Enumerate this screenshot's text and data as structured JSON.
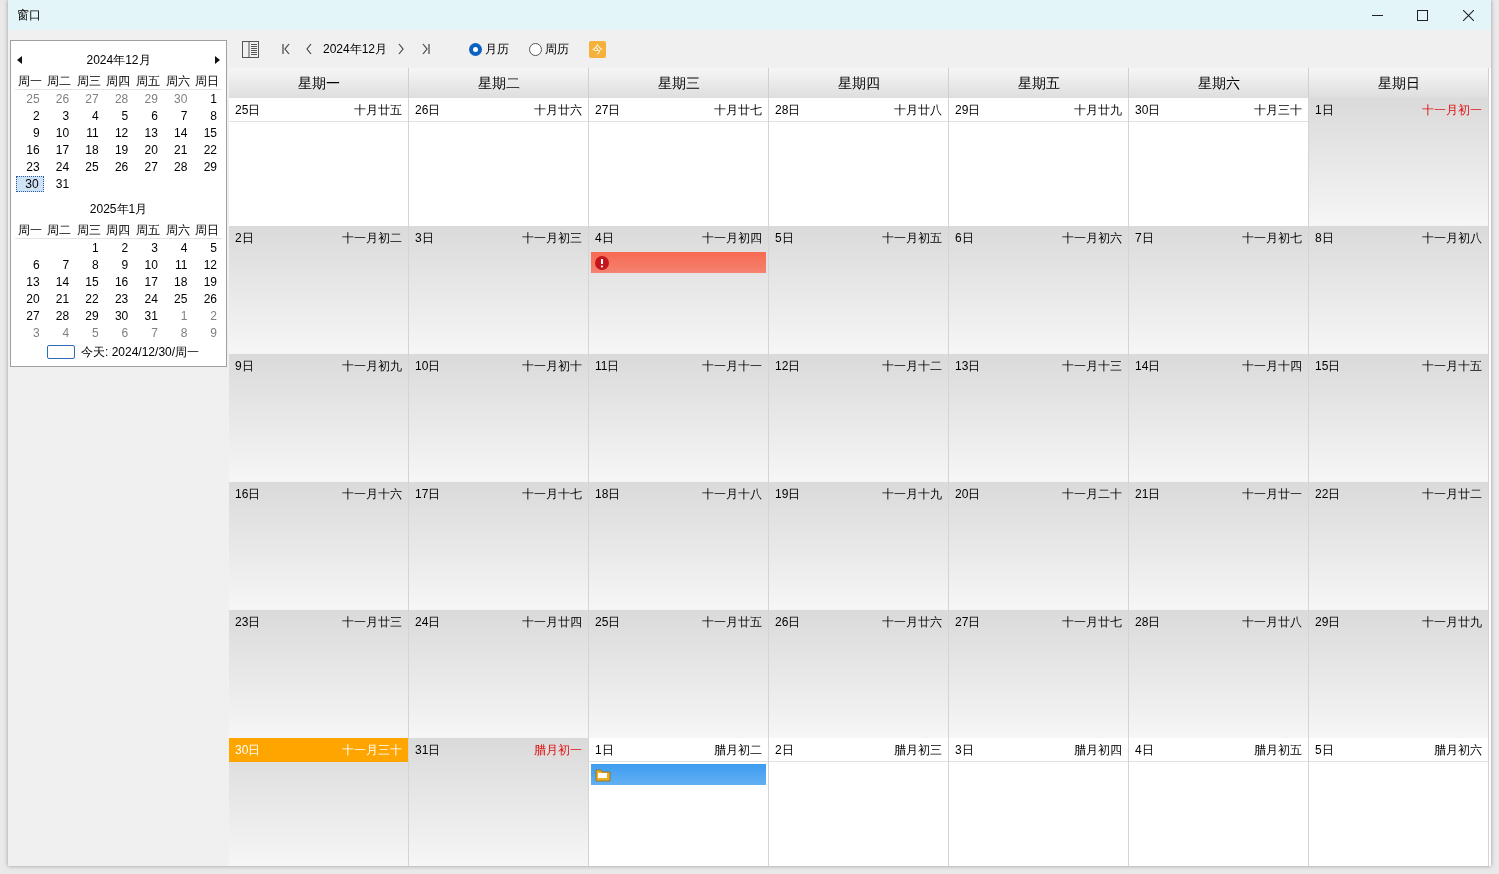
{
  "window": {
    "title": "窗口"
  },
  "mini_calendars": [
    {
      "title": "2024年12月",
      "weekdays": [
        "周一",
        "周二",
        "周三",
        "周四",
        "周五",
        "周六",
        "周日"
      ],
      "weeks": [
        [
          {
            "label": "25",
            "dim": true,
            "selected": false
          },
          {
            "label": "26",
            "dim": true,
            "selected": false
          },
          {
            "label": "27",
            "dim": true,
            "selected": false
          },
          {
            "label": "28",
            "dim": true,
            "selected": false
          },
          {
            "label": "29",
            "dim": true,
            "selected": false
          },
          {
            "label": "30",
            "dim": true,
            "selected": false
          },
          {
            "label": "1",
            "dim": false,
            "selected": false
          }
        ],
        [
          {
            "label": "2",
            "dim": false,
            "selected": false
          },
          {
            "label": "3",
            "dim": false,
            "selected": false
          },
          {
            "label": "4",
            "dim": false,
            "selected": false
          },
          {
            "label": "5",
            "dim": false,
            "selected": false
          },
          {
            "label": "6",
            "dim": false,
            "selected": false
          },
          {
            "label": "7",
            "dim": false,
            "selected": false
          },
          {
            "label": "8",
            "dim": false,
            "selected": false
          }
        ],
        [
          {
            "label": "9",
            "dim": false,
            "selected": false
          },
          {
            "label": "10",
            "dim": false,
            "selected": false
          },
          {
            "label": "11",
            "dim": false,
            "selected": false
          },
          {
            "label": "12",
            "dim": false,
            "selected": false
          },
          {
            "label": "13",
            "dim": false,
            "selected": false
          },
          {
            "label": "14",
            "dim": false,
            "selected": false
          },
          {
            "label": "15",
            "dim": false,
            "selected": false
          }
        ],
        [
          {
            "label": "16",
            "dim": false,
            "selected": false
          },
          {
            "label": "17",
            "dim": false,
            "selected": false
          },
          {
            "label": "18",
            "dim": false,
            "selected": false
          },
          {
            "label": "19",
            "dim": false,
            "selected": false
          },
          {
            "label": "20",
            "dim": false,
            "selected": false
          },
          {
            "label": "21",
            "dim": false,
            "selected": false
          },
          {
            "label": "22",
            "dim": false,
            "selected": false
          }
        ],
        [
          {
            "label": "23",
            "dim": false,
            "selected": false
          },
          {
            "label": "24",
            "dim": false,
            "selected": false
          },
          {
            "label": "25",
            "dim": false,
            "selected": false
          },
          {
            "label": "26",
            "dim": false,
            "selected": false
          },
          {
            "label": "27",
            "dim": false,
            "selected": false
          },
          {
            "label": "28",
            "dim": false,
            "selected": false
          },
          {
            "label": "29",
            "dim": false,
            "selected": false
          }
        ],
        [
          {
            "label": "30",
            "dim": false,
            "selected": true
          },
          {
            "label": "31",
            "dim": false,
            "selected": false
          }
        ]
      ]
    },
    {
      "title": "2025年1月",
      "weekdays": [
        "周一",
        "周二",
        "周三",
        "周四",
        "周五",
        "周六",
        "周日"
      ],
      "weeks": [
        [
          {
            "label": "1",
            "dim": false,
            "selected": false
          },
          {
            "label": "2",
            "dim": false,
            "selected": false
          },
          {
            "label": "3",
            "dim": false,
            "selected": false
          },
          {
            "label": "4",
            "dim": false,
            "selected": false
          },
          {
            "label": "5",
            "dim": false,
            "selected": false
          }
        ],
        [
          {
            "label": "6",
            "dim": false,
            "selected": false
          },
          {
            "label": "7",
            "dim": false,
            "selected": false
          },
          {
            "label": "8",
            "dim": false,
            "selected": false
          },
          {
            "label": "9",
            "dim": false,
            "selected": false
          },
          {
            "label": "10",
            "dim": false,
            "selected": false
          },
          {
            "label": "11",
            "dim": false,
            "selected": false
          },
          {
            "label": "12",
            "dim": false,
            "selected": false
          }
        ],
        [
          {
            "label": "13",
            "dim": false,
            "selected": false
          },
          {
            "label": "14",
            "dim": false,
            "selected": false
          },
          {
            "label": "15",
            "dim": false,
            "selected": false
          },
          {
            "label": "16",
            "dim": false,
            "selected": false
          },
          {
            "label": "17",
            "dim": false,
            "selected": false
          },
          {
            "label": "18",
            "dim": false,
            "selected": false
          },
          {
            "label": "19",
            "dim": false,
            "selected": false
          }
        ],
        [
          {
            "label": "20",
            "dim": false,
            "selected": false
          },
          {
            "label": "21",
            "dim": false,
            "selected": false
          },
          {
            "label": "22",
            "dim": false,
            "selected": false
          },
          {
            "label": "23",
            "dim": false,
            "selected": false
          },
          {
            "label": "24",
            "dim": false,
            "selected": false
          },
          {
            "label": "25",
            "dim": false,
            "selected": false
          },
          {
            "label": "26",
            "dim": false,
            "selected": false
          }
        ],
        [
          {
            "label": "27",
            "dim": false,
            "selected": false
          },
          {
            "label": "28",
            "dim": false,
            "selected": false
          },
          {
            "label": "29",
            "dim": false,
            "selected": false
          },
          {
            "label": "30",
            "dim": false,
            "selected": false
          },
          {
            "label": "31",
            "dim": false,
            "selected": false
          },
          {
            "label": "1",
            "dim": true,
            "selected": false
          },
          {
            "label": "2",
            "dim": true,
            "selected": false
          }
        ],
        [
          {
            "label": "3",
            "dim": true,
            "selected": false
          },
          {
            "label": "4",
            "dim": true,
            "selected": false
          },
          {
            "label": "5",
            "dim": true,
            "selected": false
          },
          {
            "label": "6",
            "dim": true,
            "selected": false
          },
          {
            "label": "7",
            "dim": true,
            "selected": false
          },
          {
            "label": "8",
            "dim": true,
            "selected": false
          },
          {
            "label": "9",
            "dim": true,
            "selected": false
          }
        ]
      ]
    }
  ],
  "today_label": "今天: 2024/12/30/周一",
  "toolbar": {
    "month_label": "2024年12月",
    "views": [
      {
        "label": "月历",
        "selected": true
      },
      {
        "label": "周历",
        "selected": false
      }
    ],
    "today_button": "今"
  },
  "calendar": {
    "weekdays": [
      "星期一",
      "星期二",
      "星期三",
      "星期四",
      "星期五",
      "星期六",
      "星期日"
    ],
    "weeks": [
      [
        {
          "date": "25日",
          "lunar": "十月廿五",
          "other_month": true,
          "today": false,
          "lunar_highlight": false
        },
        {
          "date": "26日",
          "lunar": "十月廿六",
          "other_month": true,
          "today": false,
          "lunar_highlight": false
        },
        {
          "date": "27日",
          "lunar": "十月廿七",
          "other_month": true,
          "today": false,
          "lunar_highlight": false
        },
        {
          "date": "28日",
          "lunar": "十月廿八",
          "other_month": true,
          "today": false,
          "lunar_highlight": false
        },
        {
          "date": "29日",
          "lunar": "十月廿九",
          "other_month": true,
          "today": false,
          "lunar_highlight": false
        },
        {
          "date": "30日",
          "lunar": "十月三十",
          "other_month": true,
          "today": false,
          "lunar_highlight": false
        },
        {
          "date": "1日",
          "lunar": "十一月初一",
          "other_month": false,
          "today": false,
          "lunar_highlight": true
        }
      ],
      [
        {
          "date": "2日",
          "lunar": "十一月初二",
          "other_month": false,
          "today": false,
          "lunar_highlight": false
        },
        {
          "date": "3日",
          "lunar": "十一月初三",
          "other_month": false,
          "today": false,
          "lunar_highlight": false
        },
        {
          "date": "4日",
          "lunar": "十一月初四",
          "other_month": false,
          "today": false,
          "lunar_highlight": false,
          "events": [
            {
              "kind": "alert",
              "color": "#f86a52"
            }
          ]
        },
        {
          "date": "5日",
          "lunar": "十一月初五",
          "other_month": false,
          "today": false,
          "lunar_highlight": false
        },
        {
          "date": "6日",
          "lunar": "十一月初六",
          "other_month": false,
          "today": false,
          "lunar_highlight": false
        },
        {
          "date": "7日",
          "lunar": "十一月初七",
          "other_month": false,
          "today": false,
          "lunar_highlight": false
        },
        {
          "date": "8日",
          "lunar": "十一月初八",
          "other_month": false,
          "today": false,
          "lunar_highlight": false
        }
      ],
      [
        {
          "date": "9日",
          "lunar": "十一月初九",
          "other_month": false,
          "today": false,
          "lunar_highlight": false
        },
        {
          "date": "10日",
          "lunar": "十一月初十",
          "other_month": false,
          "today": false,
          "lunar_highlight": false
        },
        {
          "date": "11日",
          "lunar": "十一月十一",
          "other_month": false,
          "today": false,
          "lunar_highlight": false
        },
        {
          "date": "12日",
          "lunar": "十一月十二",
          "other_month": false,
          "today": false,
          "lunar_highlight": false
        },
        {
          "date": "13日",
          "lunar": "十一月十三",
          "other_month": false,
          "today": false,
          "lunar_highlight": false
        },
        {
          "date": "14日",
          "lunar": "十一月十四",
          "other_month": false,
          "today": false,
          "lunar_highlight": false
        },
        {
          "date": "15日",
          "lunar": "十一月十五",
          "other_month": false,
          "today": false,
          "lunar_highlight": false
        }
      ],
      [
        {
          "date": "16日",
          "lunar": "十一月十六",
          "other_month": false,
          "today": false,
          "lunar_highlight": false
        },
        {
          "date": "17日",
          "lunar": "十一月十七",
          "other_month": false,
          "today": false,
          "lunar_highlight": false
        },
        {
          "date": "18日",
          "lunar": "十一月十八",
          "other_month": false,
          "today": false,
          "lunar_highlight": false
        },
        {
          "date": "19日",
          "lunar": "十一月十九",
          "other_month": false,
          "today": false,
          "lunar_highlight": false
        },
        {
          "date": "20日",
          "lunar": "十一月二十",
          "other_month": false,
          "today": false,
          "lunar_highlight": false
        },
        {
          "date": "21日",
          "lunar": "十一月廿一",
          "other_month": false,
          "today": false,
          "lunar_highlight": false
        },
        {
          "date": "22日",
          "lunar": "十一月廿二",
          "other_month": false,
          "today": false,
          "lunar_highlight": false
        }
      ],
      [
        {
          "date": "23日",
          "lunar": "十一月廿三",
          "other_month": false,
          "today": false,
          "lunar_highlight": false
        },
        {
          "date": "24日",
          "lunar": "十一月廿四",
          "other_month": false,
          "today": false,
          "lunar_highlight": false
        },
        {
          "date": "25日",
          "lunar": "十一月廿五",
          "other_month": false,
          "today": false,
          "lunar_highlight": false
        },
        {
          "date": "26日",
          "lunar": "十一月廿六",
          "other_month": false,
          "today": false,
          "lunar_highlight": false
        },
        {
          "date": "27日",
          "lunar": "十一月廿七",
          "other_month": false,
          "today": false,
          "lunar_highlight": false
        },
        {
          "date": "28日",
          "lunar": "十一月廿八",
          "other_month": false,
          "today": false,
          "lunar_highlight": false
        },
        {
          "date": "29日",
          "lunar": "十一月廿九",
          "other_month": false,
          "today": false,
          "lunar_highlight": false
        }
      ],
      [
        {
          "date": "30日",
          "lunar": "十一月三十",
          "other_month": false,
          "today": true,
          "lunar_highlight": false
        },
        {
          "date": "31日",
          "lunar": "腊月初一",
          "other_month": false,
          "today": false,
          "lunar_highlight": true
        },
        {
          "date": "1日",
          "lunar": "腊月初二",
          "other_month": true,
          "today": false,
          "lunar_highlight": false,
          "events": [
            {
              "kind": "note",
              "color": "#3d9cf0"
            }
          ]
        },
        {
          "date": "2日",
          "lunar": "腊月初三",
          "other_month": true,
          "today": false,
          "lunar_highlight": false
        },
        {
          "date": "3日",
          "lunar": "腊月初四",
          "other_month": true,
          "today": false,
          "lunar_highlight": false
        },
        {
          "date": "4日",
          "lunar": "腊月初五",
          "other_month": true,
          "today": false,
          "lunar_highlight": false
        },
        {
          "date": "5日",
          "lunar": "腊月初六",
          "other_month": true,
          "today": false,
          "lunar_highlight": false
        }
      ]
    ]
  }
}
